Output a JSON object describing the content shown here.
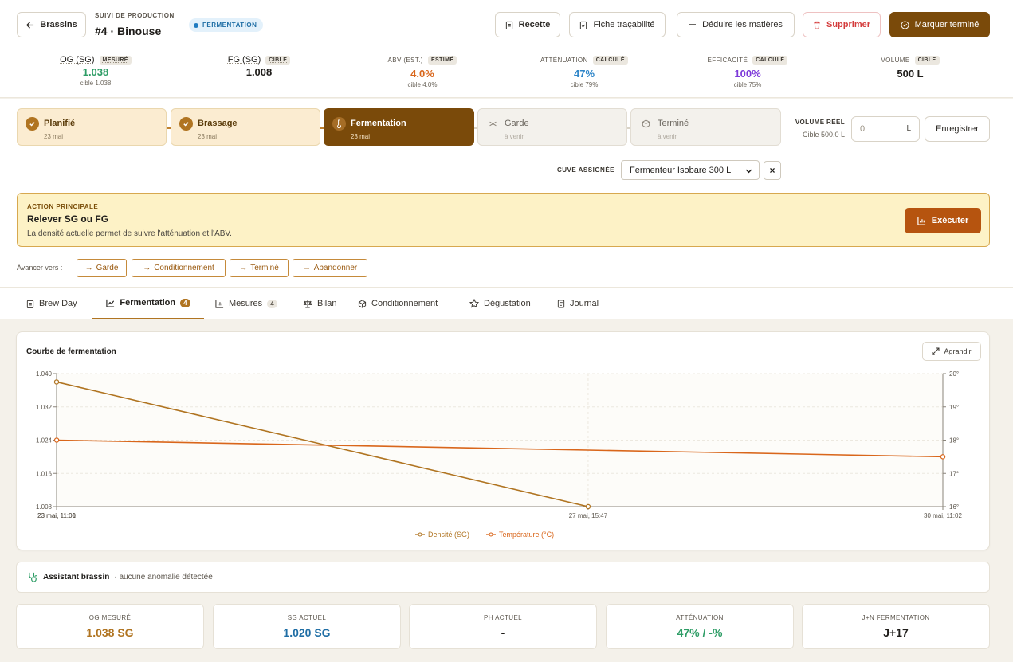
{
  "header": {
    "back_label": "Brassins",
    "subtitle": "SUIVI DE PRODUCTION",
    "title": "#4 · Binouse",
    "status_badge": "FERMENTATION",
    "actions": {
      "recipe": "Recette",
      "trace": "Fiche traçabilité",
      "deduct": "Déduire les matières",
      "delete": "Supprimer",
      "finish": "Marquer terminé"
    }
  },
  "stats": [
    {
      "label": "OG (SG)",
      "tag": "MESURÉ",
      "value": "1.038",
      "color": "#2e9d66",
      "target": "cible 1.038"
    },
    {
      "label": "FG (SG)",
      "tag": "CIBLE",
      "value": "1.008",
      "color": "#1f1d1a",
      "target": ""
    },
    {
      "label": "ABV (EST.)",
      "tag": "ESTIMÉ",
      "value": "4.0%",
      "color": "#d9661b",
      "target": "cible 4.0%"
    },
    {
      "label": "ATTÉNUATION",
      "tag": "CALCULÉ",
      "value": "47%",
      "color": "#2f86c9",
      "target": "cible 79%"
    },
    {
      "label": "EFFICACITÉ",
      "tag": "CALCULÉ",
      "value": "100%",
      "color": "#7d3ad9",
      "target": "cible 75%"
    },
    {
      "label": "VOLUME",
      "tag": "CIBLE",
      "value": "500 L",
      "color": "#1f1d1a",
      "target": ""
    }
  ],
  "steps": [
    {
      "label": "Planifié",
      "date": "23 mai",
      "state": "done"
    },
    {
      "label": "Brassage",
      "date": "23 mai",
      "state": "done"
    },
    {
      "label": "Fermentation",
      "date": "23 mai",
      "state": "active"
    },
    {
      "label": "Garde",
      "date": "à venir",
      "state": "future"
    },
    {
      "label": "Terminé",
      "date": "à venir",
      "state": "future"
    }
  ],
  "volume": {
    "label": "VOLUME RÉEL",
    "target": "Cible 500.0 L",
    "placeholder": "0",
    "unit": "L",
    "save": "Enregistrer"
  },
  "tank": {
    "label": "CUVE ASSIGNÉE",
    "selected": "Fermenteur Isobare 300 L",
    "clear": "×"
  },
  "action": {
    "kicker": "ACTION PRINCIPALE",
    "title": "Relever SG ou FG",
    "desc": "La densité actuelle permet de suivre l'atténuation et l'ABV.",
    "button": "Exécuter"
  },
  "advance": {
    "label": "Avancer vers :",
    "targets": [
      "Garde",
      "Conditionnement",
      "Terminé",
      "Abandonner"
    ]
  },
  "tabs": [
    {
      "label": "Brew Day",
      "count": ""
    },
    {
      "label": "Fermentation",
      "count": "4"
    },
    {
      "label": "Mesures",
      "count": "4"
    },
    {
      "label": "Bilan",
      "count": ""
    },
    {
      "label": "Conditionnement",
      "count": ""
    },
    {
      "label": "Dégustation",
      "count": ""
    },
    {
      "label": "Journal",
      "count": ""
    }
  ],
  "chart_card": {
    "title": "Courbe de fermentation",
    "expand": "Agrandir"
  },
  "chart_data": {
    "type": "line",
    "x": [
      "23 mai, 11:00",
      "23 mai, 11:01",
      "27 mai, 15:47",
      "30 mai, 11:02"
    ],
    "x_hours": [
      0,
      0.0167,
      100.78,
      168.03
    ],
    "series": [
      {
        "name": "Densité (SG)",
        "axis": "left",
        "color": "#b07421",
        "values": [
          1.038,
          null,
          1.008,
          null
        ]
      },
      {
        "name": "Température (°C)",
        "axis": "right",
        "color": "#d9661b",
        "values": [
          null,
          18.0,
          null,
          17.5
        ]
      }
    ],
    "ylim": [
      1.008,
      1.04
    ],
    "yticks": [
      "1.040",
      "1.032",
      "1.024",
      "1.016",
      "1.008"
    ],
    "y2lim": [
      16,
      20
    ],
    "y2ticks": [
      "20°",
      "19°",
      "18°",
      "17°",
      "16°"
    ],
    "legend_position": "bottom-center",
    "grid": true
  },
  "assistant": {
    "title": "Assistant brassin",
    "message": "· aucune anomalie détectée"
  },
  "kpis": [
    {
      "label": "OG MESURÉ",
      "value": "1.038 SG",
      "color": "#b07421"
    },
    {
      "label": "SG ACTUEL",
      "value": "1.020 SG",
      "color": "#1f6ea5"
    },
    {
      "label": "PH ACTUEL",
      "value": "-",
      "color": "#1f1d1a"
    },
    {
      "label": "ATTÉNUATION",
      "value": "47% / -%",
      "color": "#2e9d66"
    },
    {
      "label": "J+N FERMENTATION",
      "value": "J+17",
      "color": "#1f1d1a"
    }
  ]
}
